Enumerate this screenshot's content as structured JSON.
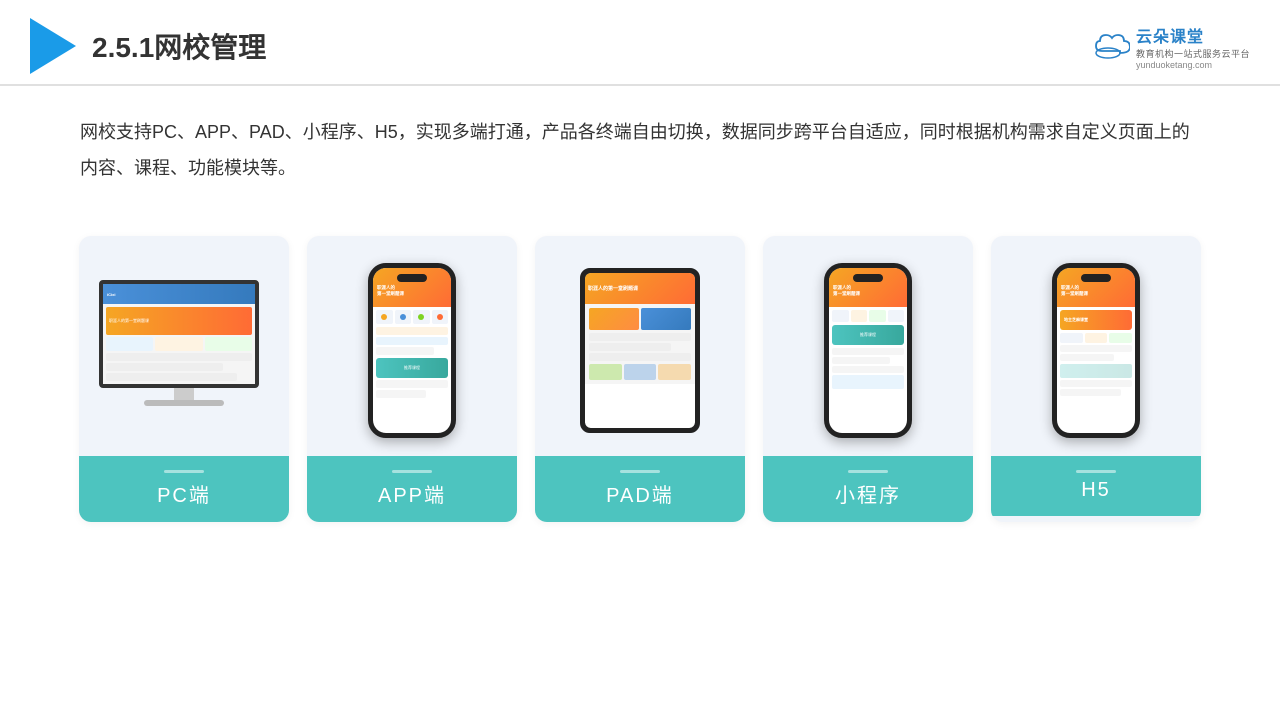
{
  "header": {
    "title": "2.5.1网校管理",
    "logo_main": "云朵课堂",
    "logo_url": "yunduoketang.com",
    "logo_tagline": "教育机构一站",
    "logo_tagline2": "式服务云平台"
  },
  "description": {
    "text": "网校支持PC、APP、PAD、小程序、H5，实现多端打通，产品各终端自由切换，数据同步跨平台自适应，同时根据机构需求自定义页面上的内容、课程、功能模块等。"
  },
  "cards": [
    {
      "id": "pc",
      "label": "PC端",
      "type": "pc"
    },
    {
      "id": "app",
      "label": "APP端",
      "type": "phone"
    },
    {
      "id": "pad",
      "label": "PAD端",
      "type": "tablet"
    },
    {
      "id": "mini",
      "label": "小程序",
      "type": "phone2"
    },
    {
      "id": "h5",
      "label": "H5",
      "type": "phone3"
    }
  ]
}
